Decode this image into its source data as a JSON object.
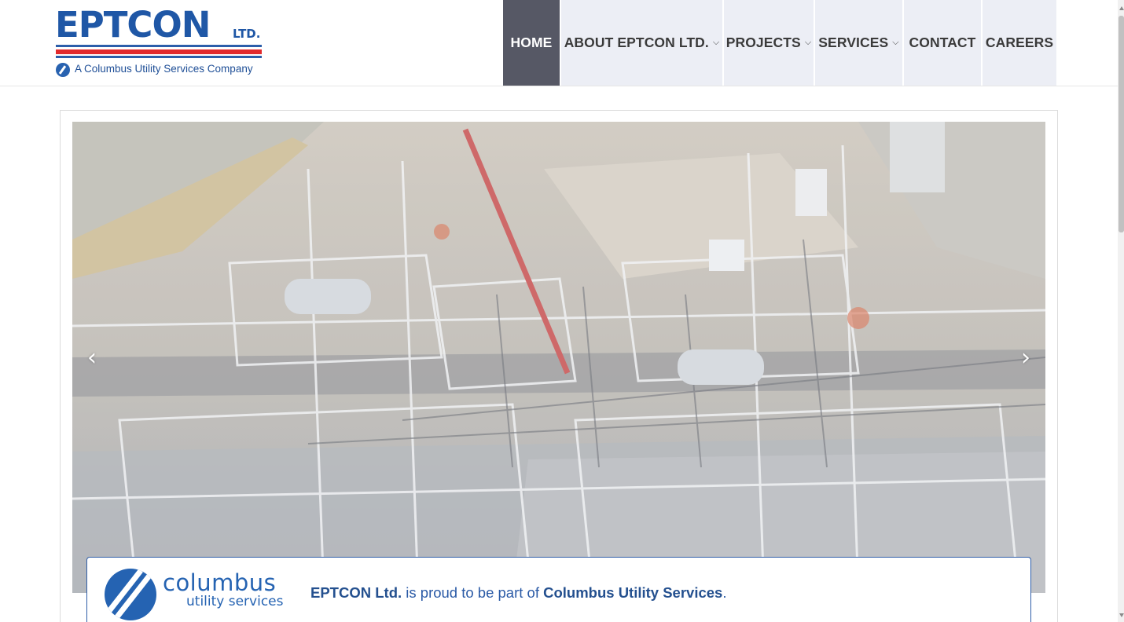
{
  "brand": {
    "name": "EPTCON",
    "suffix": "LTD.",
    "tagline": "A Columbus Utility Services Company",
    "colors": {
      "blue": "#1f57a6",
      "red": "#e22a2d"
    }
  },
  "nav": {
    "items": [
      {
        "label": "HOME",
        "has_dropdown": false,
        "active": true
      },
      {
        "label": "ABOUT EPTCON LTD.",
        "has_dropdown": true,
        "active": false
      },
      {
        "label": "PROJECTS",
        "has_dropdown": true,
        "active": false
      },
      {
        "label": "SERVICES",
        "has_dropdown": true,
        "active": false
      },
      {
        "label": "CONTACT",
        "has_dropdown": false,
        "active": false
      },
      {
        "label": "CAREERS",
        "has_dropdown": false,
        "active": false
      }
    ],
    "dropdown_icon": "chevron-down-icon",
    "active_color": "#565865",
    "inactive_color": "#eceef5"
  },
  "slider": {
    "prev_icon": "chevron-left-icon",
    "next_icon": "chevron-right-icon",
    "prev_glyph": "‹",
    "next_glyph": "›"
  },
  "announcement": {
    "partner_logo_word": "columbus",
    "partner_logo_sub": "utility services",
    "text_company": "EPTCON Ltd.",
    "text_middle": " is proud to be part of ",
    "text_partner": "Columbus Utility Services",
    "text_end": "."
  }
}
